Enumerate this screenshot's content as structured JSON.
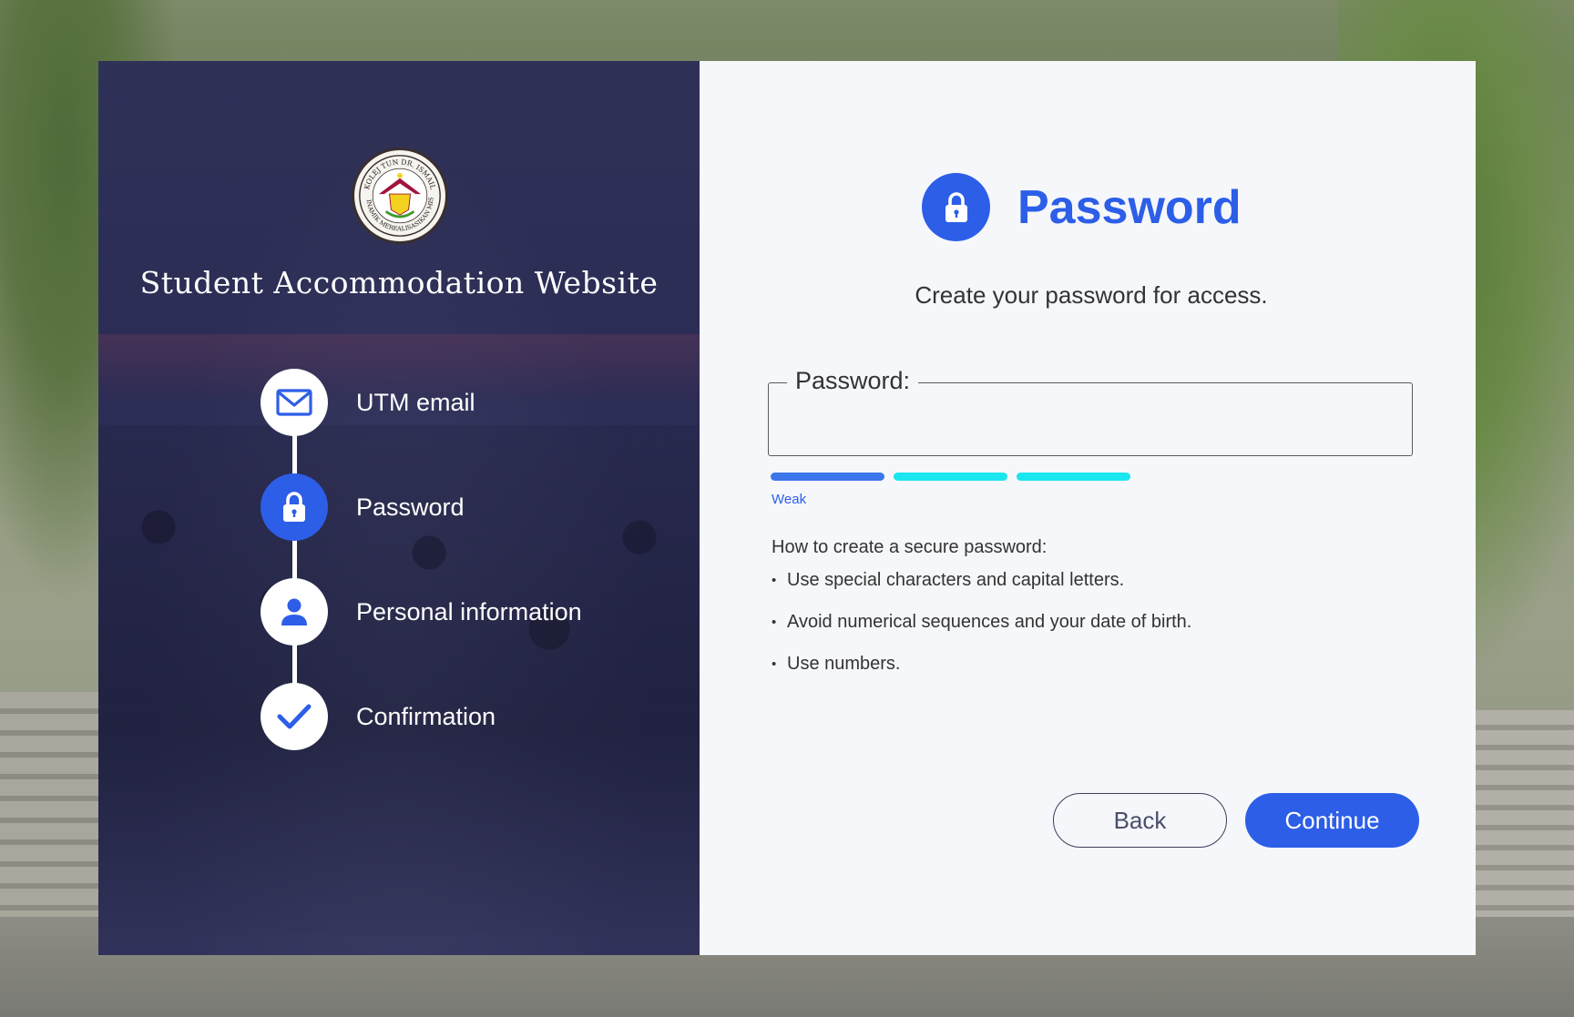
{
  "site": {
    "title": "Student Accommodation Website",
    "logo_text_top": "KOLEJ TUN DR. ISMAIL",
    "logo_text_bottom": "DINAMIK MEREALISASIKAN MISI"
  },
  "steps": [
    {
      "label": "UTM email",
      "icon": "mail-icon",
      "active": false
    },
    {
      "label": "Password",
      "icon": "lock-icon",
      "active": true
    },
    {
      "label": "Personal information",
      "icon": "person-icon",
      "active": false
    },
    {
      "label": "Confirmation",
      "icon": "check-icon",
      "active": false
    }
  ],
  "page": {
    "title": "Password",
    "subtitle": "Create your password for access.",
    "field_label": "Password:",
    "field_value": "",
    "strength": {
      "level": "Weak",
      "filled_segments": 1,
      "total_segments": 3
    },
    "tips_heading": "How to create a secure password:",
    "tips": [
      "Use special characters and capital letters.",
      "Avoid numerical sequences and your date of birth.",
      "Use numbers."
    ]
  },
  "buttons": {
    "back": "Back",
    "continue": "Continue"
  },
  "colors": {
    "accent": "#2d5ee8",
    "strength_filled": "#3b76ea",
    "strength_empty": "#19e6ee",
    "left_panel": "#2b2d55",
    "right_panel": "#f5f7fa"
  }
}
